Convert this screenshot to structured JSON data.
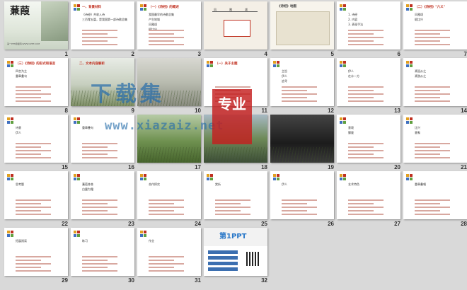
{
  "slides": [
    {
      "num": "1",
      "kind": "title",
      "title": "蒹葭",
      "caption": "第一PPT模板网-WWW.1PPT.COM"
    },
    {
      "num": "2",
      "kind": "text",
      "head": "一、背景材料",
      "lines": [
        "《诗经》共收入诗",
        "三百零五篇，是我国第一部诗歌总集"
      ]
    },
    {
      "num": "3",
      "kind": "text",
      "head": "（一）《诗经》的概述",
      "lines": [
        "我国最早的诗歌总集",
        "产生地域",
        "风雅颂",
        "赋比兴"
      ]
    },
    {
      "num": "4",
      "kind": "diagram",
      "head": "",
      "lines": [
        "风",
        "雅",
        "颂"
      ]
    },
    {
      "num": "5",
      "kind": "map",
      "head": "《诗经》地图",
      "lines": []
    },
    {
      "num": "6",
      "kind": "text",
      "head": "",
      "lines": [
        "1. 诗经",
        "2. 内容",
        "3. 表现手法"
      ]
    },
    {
      "num": "7",
      "kind": "text",
      "head": "（二）《诗经》\"六义\"",
      "lines": [
        "风雅颂",
        "赋比兴"
      ]
    },
    {
      "num": "8",
      "kind": "text",
      "head": "（三）《诗经》的形式和语言",
      "lines": [
        "四言为主",
        "重章叠句"
      ]
    },
    {
      "num": "9",
      "kind": "photo",
      "head": "二、文本内容解析",
      "lines": []
    },
    {
      "num": "10",
      "kind": "photo",
      "head": "",
      "lines": []
    },
    {
      "num": "11",
      "kind": "text",
      "head": "（一）关于主题",
      "lines": []
    },
    {
      "num": "12",
      "kind": "text",
      "head": "",
      "lines": [
        "主旨",
        "伊人",
        "追寻"
      ]
    },
    {
      "num": "13",
      "kind": "text",
      "head": "",
      "lines": [
        "伊人",
        "在水一方"
      ]
    },
    {
      "num": "14",
      "kind": "text",
      "head": "",
      "lines": [
        "溯洄从之",
        "溯游从之"
      ]
    },
    {
      "num": "15",
      "kind": "text",
      "head": "",
      "lines": [
        "诗意",
        "伊人"
      ]
    },
    {
      "num": "16",
      "kind": "text",
      "head": "",
      "lines": [
        "重章叠句"
      ]
    },
    {
      "num": "17",
      "kind": "photo",
      "head": "",
      "lines": []
    },
    {
      "num": "18",
      "kind": "photo",
      "head": "",
      "lines": []
    },
    {
      "num": "19",
      "kind": "photo",
      "head": "",
      "lines": []
    },
    {
      "num": "20",
      "kind": "text",
      "head": "",
      "lines": [
        "意境",
        "朦胧"
      ]
    },
    {
      "num": "21",
      "kind": "text",
      "head": "",
      "lines": [
        "比兴",
        "意象"
      ]
    },
    {
      "num": "22",
      "kind": "text",
      "head": "",
      "lines": [
        "思考题"
      ]
    },
    {
      "num": "23",
      "kind": "text",
      "head": "",
      "lines": [
        "蒹葭苍苍",
        "白露为霜"
      ]
    },
    {
      "num": "24",
      "kind": "text",
      "head": "",
      "lines": [
        "合作探究"
      ]
    },
    {
      "num": "25",
      "kind": "text",
      "head": "",
      "lines": [
        "赏析"
      ]
    },
    {
      "num": "26",
      "kind": "text",
      "head": "",
      "lines": [
        "伊人"
      ]
    },
    {
      "num": "27",
      "kind": "text",
      "head": "",
      "lines": [
        "艺术特色"
      ]
    },
    {
      "num": "28",
      "kind": "text",
      "head": "",
      "lines": [
        "重章叠唱"
      ]
    },
    {
      "num": "29",
      "kind": "text",
      "head": "",
      "lines": [
        "拓展阅读"
      ]
    },
    {
      "num": "30",
      "kind": "text",
      "head": "",
      "lines": [
        "练习"
      ]
    },
    {
      "num": "31",
      "kind": "text",
      "head": "",
      "lines": [
        "作业"
      ]
    },
    {
      "num": "32",
      "kind": "promo",
      "head": "第1PPT",
      "lines": []
    }
  ],
  "watermark": {
    "title": "下载集",
    "badge": "专业",
    "url": "www.xiazaiz.net"
  },
  "colors": {
    "title_red": "#c03020",
    "line_pink": "#d8a8a0",
    "water": "#6a7d8a",
    "reed": "#6a8a3a"
  }
}
